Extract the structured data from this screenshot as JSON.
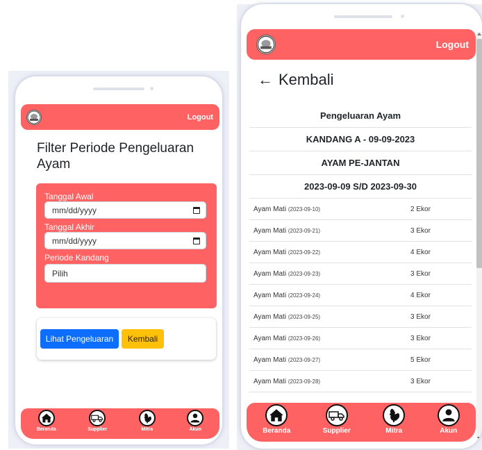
{
  "colors": {
    "accent": "#fe6263",
    "primary_button": "#0d6efd",
    "warning_button": "#ffc107"
  },
  "left_screen": {
    "header": {
      "logout_label": "Logout"
    },
    "title": "Filter Periode Pengeluaran Ayam",
    "form": {
      "start_date_label": "Tanggal Awal",
      "start_date_placeholder": "mm/dd/yyyy",
      "end_date_label": "Tanggal Akhir",
      "end_date_placeholder": "mm/dd/yyyy",
      "period_label": "Periode Kandang",
      "period_value": "Pilih"
    },
    "buttons": {
      "view_label": "Lihat Pengeluaran",
      "back_label": "Kembali"
    },
    "nav": [
      {
        "label": "Beranda",
        "icon": "home-icon"
      },
      {
        "label": "Supplier",
        "icon": "truck-icon"
      },
      {
        "label": "Mitra",
        "icon": "rooster-icon"
      },
      {
        "label": "Akun",
        "icon": "user-icon"
      }
    ]
  },
  "right_screen": {
    "header": {
      "logout_label": "Logout"
    },
    "back_label": "Kembali",
    "table_headers": [
      "Pengeluaran Ayam",
      "KANDANG A - 09-09-2023",
      "AYAM PE-JANTAN",
      "2023-09-09 S/D 2023-09-30"
    ],
    "rows": [
      {
        "item": "Ayam Mati",
        "date": "(2023-09-10)",
        "qty": "2 Ekor"
      },
      {
        "item": "Ayam Mati",
        "date": "(2023-09-21)",
        "qty": "3 Ekor"
      },
      {
        "item": "Ayam Mati",
        "date": "(2023-09-22)",
        "qty": "4 Ekor"
      },
      {
        "item": "Ayam Mati",
        "date": "(2023-09-23)",
        "qty": "3 Ekor"
      },
      {
        "item": "Ayam Mati",
        "date": "(2023-09-24)",
        "qty": "4 Ekor"
      },
      {
        "item": "Ayam Mati",
        "date": "(2023-09-25)",
        "qty": "3 Ekor"
      },
      {
        "item": "Ayam Mati",
        "date": "(2023-09-26)",
        "qty": "3 Ekor"
      },
      {
        "item": "Ayam Mati",
        "date": "(2023-09-27)",
        "qty": "5 Ekor"
      },
      {
        "item": "Ayam Mati",
        "date": "(2023-09-28)",
        "qty": "3 Ekor"
      }
    ],
    "nav": [
      {
        "label": "Beranda",
        "icon": "home-icon"
      },
      {
        "label": "Supplier",
        "icon": "truck-icon"
      },
      {
        "label": "Mitra",
        "icon": "rooster-icon"
      },
      {
        "label": "Akun",
        "icon": "user-icon"
      }
    ]
  }
}
